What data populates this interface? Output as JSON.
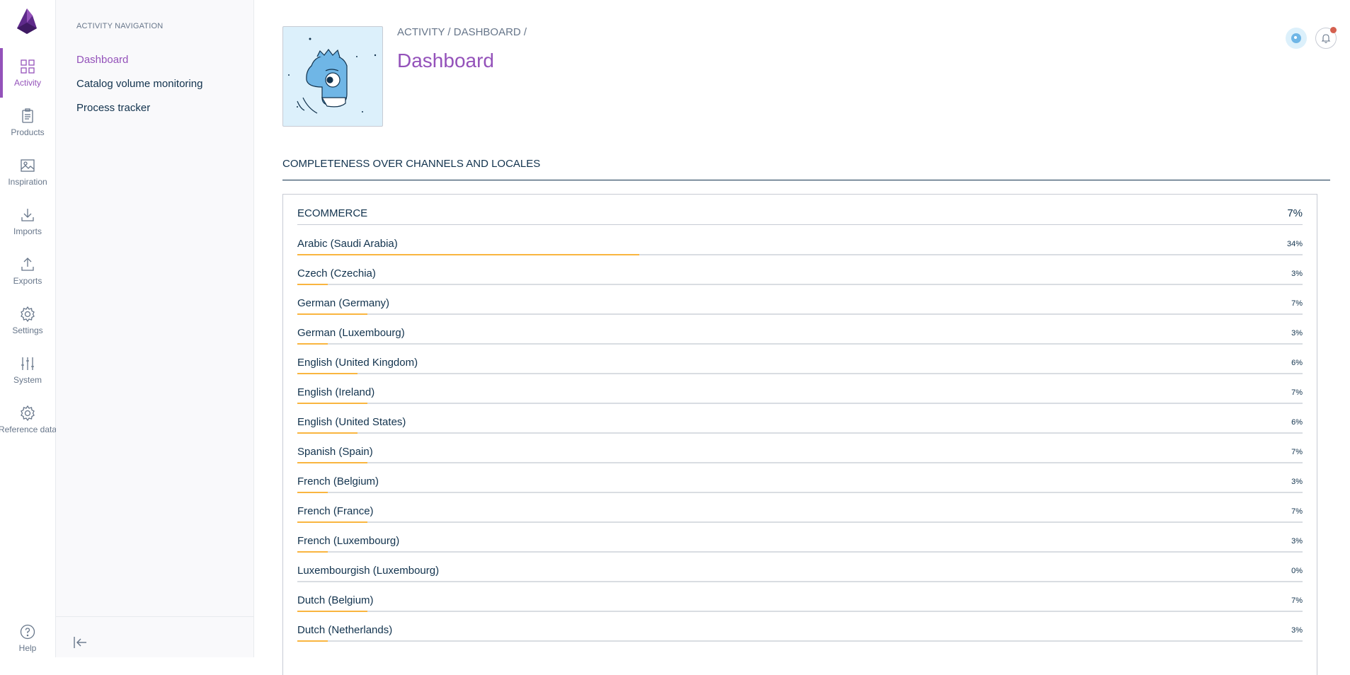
{
  "main_menu": {
    "items": [
      {
        "label": "Activity",
        "icon": "activity-icon",
        "active": true
      },
      {
        "label": "Products",
        "icon": "products-icon",
        "active": false
      },
      {
        "label": "Inspiration",
        "icon": "inspiration-icon",
        "active": false
      },
      {
        "label": "Imports",
        "icon": "imports-icon",
        "active": false
      },
      {
        "label": "Exports",
        "icon": "exports-icon",
        "active": false
      },
      {
        "label": "Settings",
        "icon": "settings-icon",
        "active": false
      },
      {
        "label": "System",
        "icon": "system-icon",
        "active": false
      },
      {
        "label": "Reference data",
        "icon": "reference-data-icon",
        "active": false
      }
    ],
    "help_label": "Help"
  },
  "sub_nav": {
    "title": "ACTIVITY NAVIGATION",
    "items": [
      {
        "label": "Dashboard",
        "active": true
      },
      {
        "label": "Catalog volume monitoring",
        "active": false
      },
      {
        "label": "Process tracker",
        "active": false
      }
    ]
  },
  "header": {
    "breadcrumb": "ACTIVITY / DASHBOARD /",
    "title": "Dashboard"
  },
  "section": {
    "title": "COMPLETENESS OVER CHANNELS AND LOCALES"
  },
  "channel": {
    "name": "ECOMMERCE",
    "completeness": "7%",
    "locales": [
      {
        "name": "Arabic (Saudi Arabia)",
        "percent": 34,
        "label": "34%"
      },
      {
        "name": "Czech (Czechia)",
        "percent": 3,
        "label": "3%"
      },
      {
        "name": "German (Germany)",
        "percent": 7,
        "label": "7%"
      },
      {
        "name": "German (Luxembourg)",
        "percent": 3,
        "label": "3%"
      },
      {
        "name": "English (United Kingdom)",
        "percent": 6,
        "label": "6%"
      },
      {
        "name": "English (Ireland)",
        "percent": 7,
        "label": "7%"
      },
      {
        "name": "English (United States)",
        "percent": 6,
        "label": "6%"
      },
      {
        "name": "Spanish (Spain)",
        "percent": 7,
        "label": "7%"
      },
      {
        "name": "French (Belgium)",
        "percent": 3,
        "label": "3%"
      },
      {
        "name": "French (France)",
        "percent": 7,
        "label": "7%"
      },
      {
        "name": "French (Luxembourg)",
        "percent": 3,
        "label": "3%"
      },
      {
        "name": "Luxembourgish (Luxembourg)",
        "percent": 0,
        "label": "0%"
      },
      {
        "name": "Dutch (Belgium)",
        "percent": 7,
        "label": "7%"
      },
      {
        "name": "Dutch (Netherlands)",
        "percent": 3,
        "label": "3%"
      }
    ]
  },
  "colors": {
    "accent": "#9452ba",
    "progress": "#f9b53f",
    "track": "#d9dde2",
    "notification": "#d4604f"
  }
}
